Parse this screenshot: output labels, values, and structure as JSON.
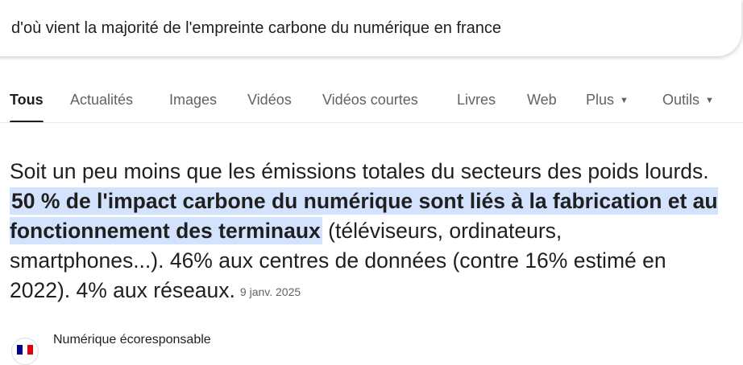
{
  "search": {
    "query": "d'où vient la majorité de l'empreinte carbone du numérique en france"
  },
  "tabs": [
    {
      "label": "Tous",
      "active": true
    },
    {
      "label": "Actualités"
    },
    {
      "label": "Images"
    },
    {
      "label": "Vidéos"
    },
    {
      "label": "Vidéos courtes"
    },
    {
      "label": "Livres"
    },
    {
      "label": "Web"
    },
    {
      "label": "Plus",
      "icon": "chevron-down-icon"
    },
    {
      "label": "Outils",
      "icon": "chevron-down-icon"
    }
  ],
  "answer": {
    "text_before": "Soit un peu moins que les émissions totales du secteurs des poids lourds. ",
    "highlight": "50 % de l'impact carbone du numérique sont liés à la fabrication et au fonctionnement des terminaux",
    "text_after": " (téléviseurs, ordinateurs, smartphones...). 46% aux centres de données (contre 16% estimé en 2022). 4% aux réseaux.",
    "date": "9 janv. 2025"
  },
  "source": {
    "name": "Numérique écoresponsable",
    "logo_icon": "french-flag-icon"
  },
  "colors": {
    "highlight": "#d3e3fd",
    "tab_inactive": "#5f6368",
    "text": "#1f1f1f"
  }
}
